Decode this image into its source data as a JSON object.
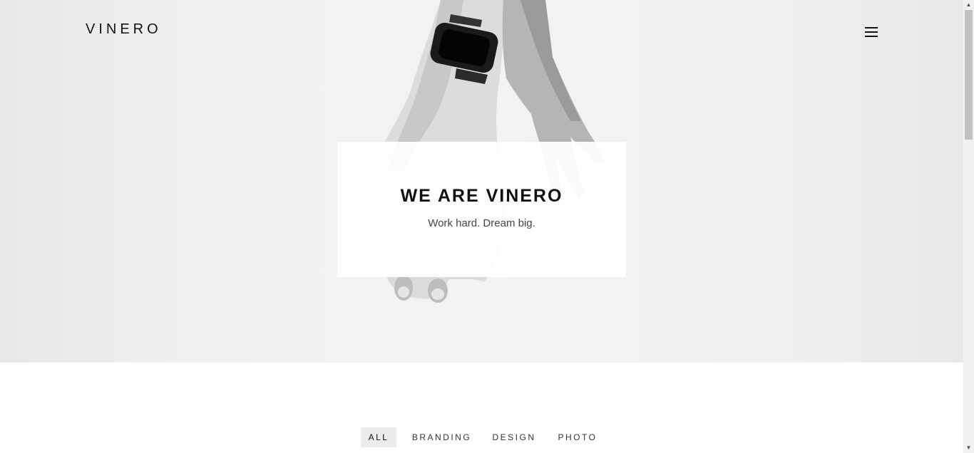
{
  "header": {
    "logo": "VINERO",
    "menu_icon": "hamburger-icon"
  },
  "hero": {
    "title": "WE ARE VINERO",
    "subtitle": "Work hard. Dream big."
  },
  "filters": {
    "items": [
      {
        "label": "ALL",
        "active": true
      },
      {
        "label": "BRANDING",
        "active": false
      },
      {
        "label": "DESIGN",
        "active": false
      },
      {
        "label": "PHOTO",
        "active": false
      }
    ]
  },
  "colors": {
    "text": "#111111",
    "active_filter_bg": "#ececec",
    "hero_bg": "#f0f0f0"
  }
}
